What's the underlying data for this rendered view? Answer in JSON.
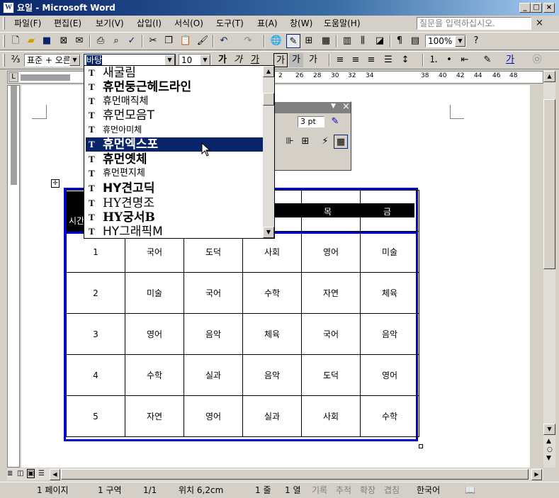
{
  "window": {
    "title": "요일 - Microsoft Word",
    "icon_letter": "W",
    "min": "_",
    "max": "□",
    "close": "×"
  },
  "menu": {
    "items": [
      "파일(F)",
      "편집(E)",
      "보기(V)",
      "삽입(I)",
      "서식(O)",
      "도구(T)",
      "표(A)",
      "창(W)",
      "도움말(H)"
    ],
    "help_placeholder": "질문을 입력하십시오.",
    "help_close": "×"
  },
  "toolbar1": {
    "zoom": "100%"
  },
  "toolbar2": {
    "style": "표준 + 오른",
    "font_input": "바탕",
    "size": "10"
  },
  "ruler": {
    "numbers": [
      "2",
      "26",
      "28",
      "30",
      "32",
      "34",
      "38",
      "40",
      "42",
      "44",
      "46",
      "48"
    ],
    "left_mark": "L"
  },
  "font_dropdown": {
    "items": [
      {
        "name": "새굴림",
        "weight": "normal"
      },
      {
        "name": "휴먼둥근헤드라인",
        "weight": "bold"
      },
      {
        "name": "휴먼매직체",
        "weight": "normal"
      },
      {
        "name": "휴먼모음T",
        "weight": "normal"
      },
      {
        "name": "휴먼아미체",
        "weight": "normal"
      },
      {
        "name": "휴먼엑스포",
        "weight": "bold"
      },
      {
        "name": "휴먼옛체",
        "weight": "bold"
      },
      {
        "name": "휴먼편지체",
        "weight": "normal"
      },
      {
        "name": "HY견고딕",
        "weight": "bold"
      },
      {
        "name": "HY견명조",
        "weight": "normal"
      },
      {
        "name": "HY궁서B",
        "weight": "bold"
      },
      {
        "name": "HY그래픽M",
        "weight": "normal"
      }
    ],
    "selected_index": 5,
    "icon_glyph": "T"
  },
  "floating_toolbar": {
    "pt_value": "3 pt"
  },
  "table": {
    "header": [
      "시간",
      "",
      "",
      "",
      "목",
      "금"
    ],
    "rows": [
      [
        "1",
        "국어",
        "도덕",
        "사회",
        "영어",
        "미술"
      ],
      [
        "2",
        "미술",
        "국어",
        "수학",
        "자연",
        "체육"
      ],
      [
        "3",
        "영어",
        "음악",
        "체육",
        "국어",
        "음악"
      ],
      [
        "4",
        "수학",
        "실과",
        "음악",
        "도덕",
        "영어"
      ],
      [
        "5",
        "자연",
        "영어",
        "실과",
        "사회",
        "수학"
      ]
    ]
  },
  "status": {
    "page": "1 페이지",
    "section": "1 구역",
    "pages": "1/1",
    "position": "위치 6,2cm",
    "line": "1 줄",
    "column": "1 열",
    "rec": "기록",
    "trk": "추적",
    "ext": "확장",
    "ovr": "겹침",
    "language": "한국어"
  },
  "colors": {
    "titlebar": "#0a246a",
    "selection": "#0a246a",
    "table_border": "#0000cc",
    "header_fill": "#000000"
  }
}
